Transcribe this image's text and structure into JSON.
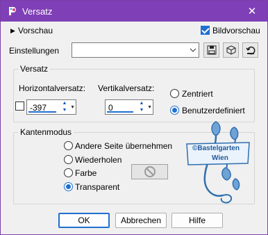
{
  "window": {
    "title": "Versatz",
    "close_glyph": "✕"
  },
  "toolbar": {
    "preview_toggle_label": "Vorschau",
    "image_preview_label": "Bildvorschau",
    "settings_label": "Einstellungen",
    "settings_value": ""
  },
  "offset_group": {
    "title": "Versatz",
    "horizontal_label": "Horizontalversatz:",
    "vertical_label": "Vertikalversatz:",
    "horizontal_value": "-397",
    "vertical_value": "0",
    "centered_label": "Zentriert",
    "custom_label": "Benutzerdefiniert"
  },
  "edge_group": {
    "title": "Kantenmodus",
    "options": [
      "Andere Seite übernehmen",
      "Wiederholen",
      "Farbe",
      "Transparent"
    ]
  },
  "watermark": {
    "line1": "©Bastelgarten",
    "line2": "Wien"
  },
  "buttons": {
    "ok": "OK",
    "cancel": "Abbrechen",
    "help": "Hilfe"
  },
  "colors": {
    "titlebar": "#7f3fb6",
    "accent": "#1f6fd1",
    "watermark": "#2f6fb0"
  }
}
